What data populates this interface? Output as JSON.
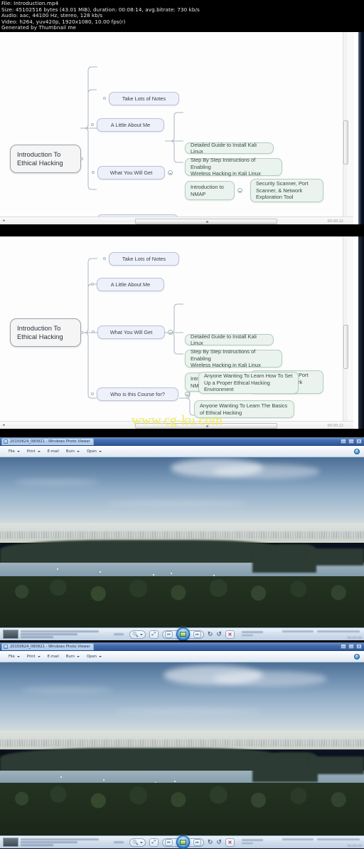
{
  "mediainfo": {
    "file": "File: Introduction.mp4",
    "size": "Size: 45102516 bytes (43.01 MiB), duration: 00:08:14, avg.bitrate: 730 kb/s",
    "audio": "Audio: aac, 44100 Hz, stereo, 128 kb/s",
    "video": "Video: h264, yuv420p, 1920x1080, 10.00 fps(r)",
    "generator": "Generated by Thumbnail me"
  },
  "mindmap": {
    "root": "Introduction To\nEthical Hacking",
    "branches": [
      {
        "label": "Take Lots of Notes"
      },
      {
        "label": "A Little About Me"
      },
      {
        "label": "What You Will Get"
      },
      {
        "label": "Who is this Course for?"
      }
    ],
    "what_you_will_get_children": [
      "Detailed Guide to Install Kali Linux",
      "Step By Step Instructions of Enabling\nWireless Hacking in Kali Linux",
      "Introduction to\nNMAP"
    ],
    "nmap_child": "Security Scanner, Port\nScanner, & Network\nExploration Tool",
    "who_is_course_for_children": [
      "Anyone Wanting To Learn How To Set\nUp a Proper Ethical Hacking\nEnvironment",
      "Anyone Wanting To Learn The Basics\nof Ethical Hacking"
    ],
    "timestamp": "00:00:12"
  },
  "watermark": "www.cg-ku.com",
  "photo_viewer": {
    "title": "20150624_080921 - Windows Photo Viewer",
    "window_buttons": [
      "—",
      "□",
      "✕"
    ],
    "menu": [
      {
        "label": "File",
        "caret": true
      },
      {
        "label": "Print",
        "caret": true
      },
      {
        "label": "E-mail",
        "caret": false
      },
      {
        "label": "Burn",
        "caret": true
      },
      {
        "label": "Open",
        "caret": true
      }
    ],
    "help_label": "?",
    "controls": {
      "zoom": "zoom-icon",
      "fit": "fit-to-window-icon",
      "previous": "previous-icon",
      "play": "slideshow-icon",
      "next": "next-icon",
      "rotate_left": "rotate-counterclockwise-icon",
      "rotate_right": "rotate-clockwise-icon",
      "delete": "✕"
    },
    "timestamp": "00:00:00"
  },
  "colors": {
    "title_blue": "#2d5698",
    "node_blue": "#eef1fa",
    "node_green": "#eaf3ee",
    "watermark_yellow": "#f5f06a",
    "delete_red": "#c12b2b"
  }
}
